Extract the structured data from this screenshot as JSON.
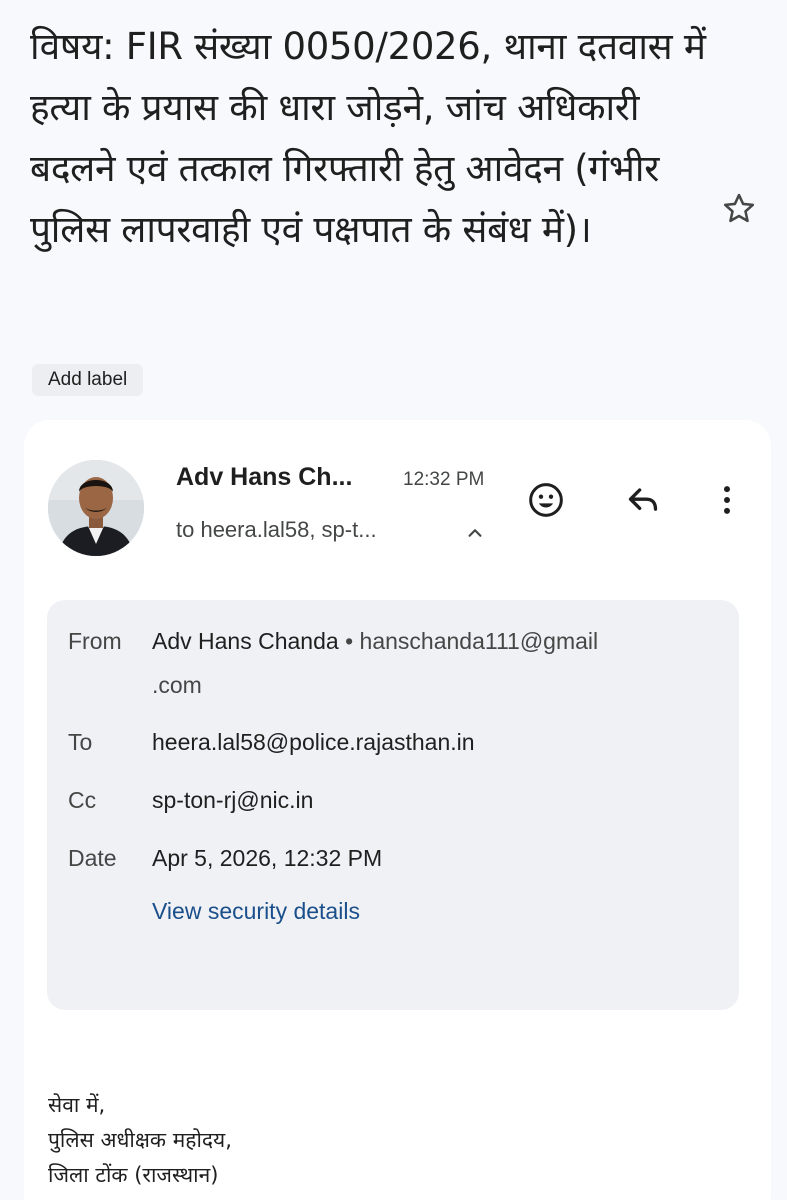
{
  "subject": "विषय: FIR संख्या 0050/2026, थाना दतवास में हत्या के प्रयास की धारा जोड़ने, जांच अधिकारी बदलने एवं तत्काल गिरफ्तारी हेतु आवेदन (गंभीर पुलिस लापरवाही एवं पक्षपात के संबंध में)।",
  "label_chip": "Add label",
  "message": {
    "sender_short": "Adv Hans Ch...",
    "time": "12:32 PM",
    "recipients_short": "to heera.lal58, sp-t..."
  },
  "details": {
    "from_label": "From",
    "from_name": "Adv Hans Chanda",
    "from_sep": " • ",
    "from_email_line1": "hanschanda111@gmail",
    "from_email_line2": ".com",
    "to_label": "To",
    "to_value": "heera.lal58@police.rajasthan.in",
    "cc_label": "Cc",
    "cc_value": "sp-ton-rj@nic.in",
    "date_label": "Date",
    "date_value": "Apr 5, 2026, 12:32 PM",
    "security_link": "View security details"
  },
  "body_lines": [
    "सेवा में,",
    "पुलिस अधीक्षक महोदय,",
    "जिला टोंक (राजस्थान)"
  ],
  "icons": [
    "star-icon",
    "emoji-icon",
    "reply-icon",
    "more-vert-icon",
    "chevron-up-icon"
  ],
  "colors": {
    "link": "#1a4f8b",
    "card": "#ffffff",
    "details_bg": "#f0f1f5",
    "page_bg": "#f8f9fc"
  }
}
